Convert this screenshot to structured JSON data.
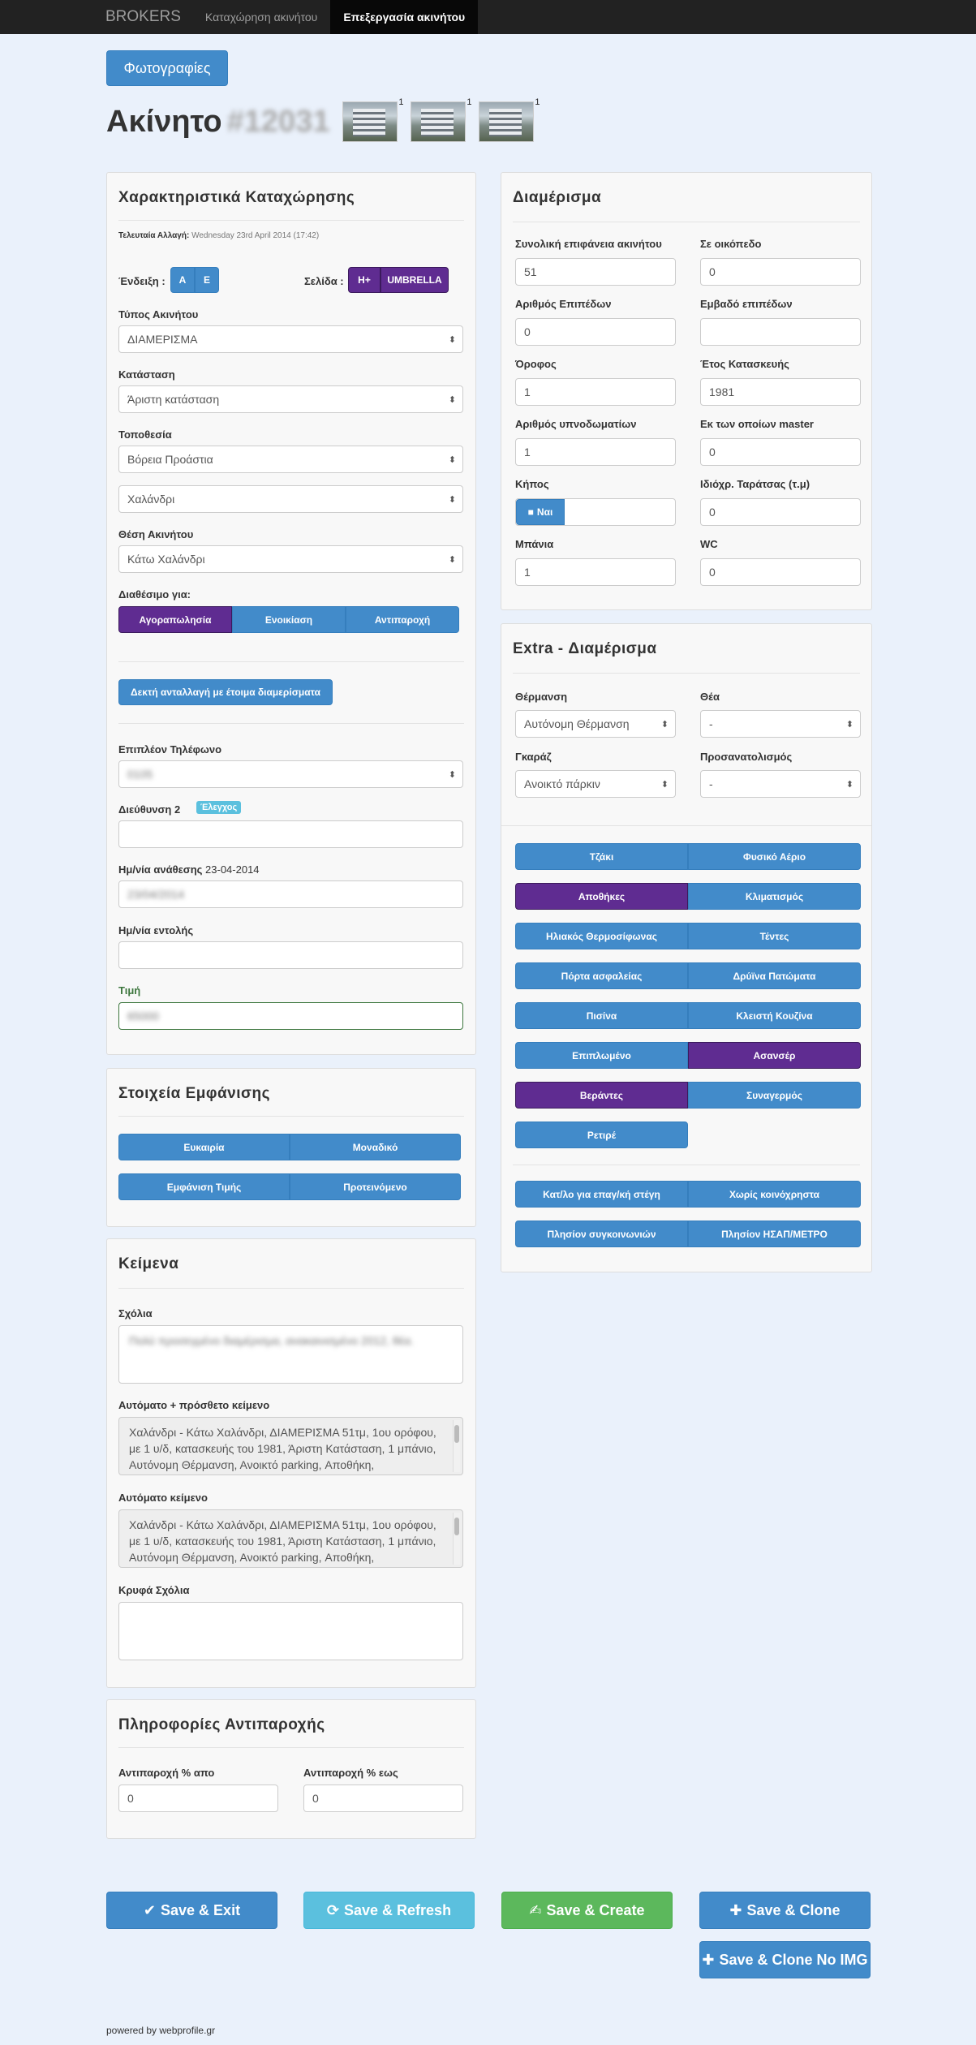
{
  "nav": {
    "brand": "BROKERS",
    "links": [
      "Καταχώρηση ακινήτου",
      "Επεξεργασία ακινήτου"
    ]
  },
  "photos_btn": "Φωτογραφίες",
  "title": {
    "label": "Ακίνητο",
    "id": "#12031",
    "thumb_counts": [
      "1",
      "1",
      "1"
    ]
  },
  "listing": {
    "heading": "Χαρακτηριστικά Καταχώρησης",
    "last_change_label": "Τελευταία Αλλαγή:",
    "last_change_value": "Wednesday 23rd April 2014 (17:42)",
    "indication_label": "Ένδειξη :",
    "indication_opts": [
      "A",
      "E"
    ],
    "page_label": "Σελίδα :",
    "page_opts": [
      "H+",
      "UMBRELLA"
    ],
    "type_label": "Τύπος Ακινήτου",
    "type_value": "ΔΙΑΜΕΡΙΣΜΑ",
    "condition_label": "Κατάσταση",
    "condition_value": "Άριστη κατάσταση",
    "location_label": "Τοποθεσία",
    "location_value": "Βόρεια Προάστια",
    "location_value2": "Χαλάνδρι",
    "position_label": "Θέση Ακινήτου",
    "position_value": "Κάτω Χαλάνδρι",
    "avail_label": "Διαθέσιμο για:",
    "avail_opts": [
      "Αγοραπωλησία",
      "Ενοικίαση",
      "Αντιπαροχή"
    ],
    "exchange_btn": "Δεκτή ανταλλαγή με έτοιμα διαμερίσματα",
    "phone_label": "Επιπλέον Τηλέφωνο",
    "phone_value": "0105",
    "addr_label": "Διεύθυνση 2",
    "addr_badge": "Έλεγχος",
    "assign_label": "Ημ/νία ανάθεσης",
    "assign_date": "23-04-2014",
    "assign_value": "23/04/2014",
    "order_label": "Ημ/νία εντολής",
    "price_label": "Τιμή",
    "price_value": "65000"
  },
  "display": {
    "heading": "Στοιχεία Εμφάνισης",
    "opts": [
      "Ευκαιρία",
      "Μοναδικό",
      "Εμφάνιση Τιμής",
      "Προτεινόμενο"
    ]
  },
  "texts": {
    "heading": "Κείμενα",
    "comments_label": "Σχόλια",
    "comments_value": "Πολύ προσεγμένο διαμέρισμα, ανακαινισμένο 2012, θέα.",
    "auto_plus_label": "Αυτόματο + πρόσθετο κείμενο",
    "auto_plus_value": "Χαλάνδρι - Κάτω Χαλάνδρι, ΔΙΑΜΕΡΙΣΜΑ 51τμ, 1ου ορόφου, με 1 υ/δ, κατασκευής του 1981, Άριστη Κατάσταση, 1 μπάνιο, Αυτόνομη Θέρμανση, Ανοικτό parking, Αποθήκη,",
    "auto_label": "Αυτόματο κείμενο",
    "auto_value": "Χαλάνδρι - Κάτω Χαλάνδρι, ΔΙΑΜΕΡΙΣΜΑ 51τμ, 1ου ορόφου, με 1 υ/δ, κατασκευής του 1981, Άριστη Κατάσταση, 1 μπάνιο, Αυτόνομη Θέρμανση, Ανοικτό parking, Αποθήκη,",
    "hidden_label": "Κρυφά Σχόλια"
  },
  "exchange": {
    "heading": "Πληροφορίες Αντιπαροχής",
    "from_label": "Αντιπαροχή % απο",
    "from_value": "0",
    "to_label": "Αντιπαροχή % εως",
    "to_value": "0"
  },
  "apartment": {
    "heading": "Διαμέρισμα",
    "total_area_label": "Συνολική επιφάνεια ακινήτου",
    "total_area": "51",
    "plot_label": "Σε οικόπεδο",
    "plot": "0",
    "levels_label": "Αριθμός Επιπέδων",
    "levels": "0",
    "levels_area_label": "Εμβαδό επιπέδων",
    "levels_area": "",
    "floor_label": "Όροφος",
    "floor": "1",
    "year_label": "Έτος Κατασκευής",
    "year": "1981",
    "bedrooms_label": "Αριθμός υπνοδωματίων",
    "bedrooms": "1",
    "master_label": "Εκ των οποίων master",
    "master": "0",
    "garden_label": "Κήπος",
    "garden_btn": "Ναι",
    "terrace_label": "Ιδιόχρ. Ταράτσας (τ.μ)",
    "terrace": "0",
    "baths_label": "Μπάνια",
    "baths": "1",
    "wc_label": "WC",
    "wc": "0"
  },
  "extra": {
    "heading": "Extra - Διαμέρισμα",
    "heating_label": "Θέρμανση",
    "heating": "Αυτόνομη Θέρμανση",
    "view_label": "Θέα",
    "view": "-",
    "garage_label": "Γκαράζ",
    "garage": "Ανοικτό πάρκιν",
    "orient_label": "Προσανατολισμός",
    "orient": "-",
    "features": [
      "Τζάκι",
      "Φυσικό Αέριο",
      "Αποθήκες",
      "Κλιματισμός",
      "Ηλιακός Θερμοσίφωνας",
      "Τέντες",
      "Πόρτα ασφαλείας",
      "Δρύϊνα Πατώματα",
      "Πισίνα",
      "Κλειστή Κουζίνα",
      "Επιπλωμένο",
      "Ασανσέρ",
      "Βεράντες",
      "Συναγερμός",
      "Ρετιρέ"
    ],
    "features2": [
      "Κατ/λο για επαγ/κή στέγη",
      "Χωρίς κοινόχρηστα",
      "Πλησίον συγκοινωνιών",
      "Πλησίον ΗΣΑΠ/ΜΕΤΡΟ"
    ]
  },
  "actions": {
    "save_exit": "Save & Exit",
    "save_refresh": "Save & Refresh",
    "save_create": "Save & Create",
    "save_clone": "Save & Clone",
    "save_clone_noimg": "Save & Clone No IMG"
  },
  "footer": "powered by webprofile.gr"
}
